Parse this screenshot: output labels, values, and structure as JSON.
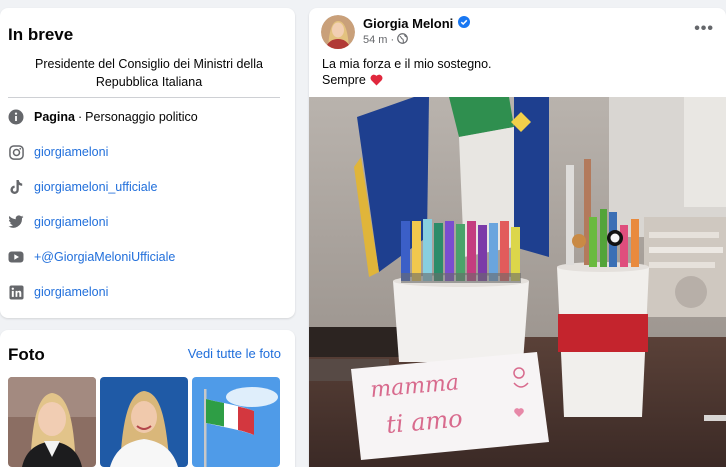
{
  "intro": {
    "title": "In breve",
    "bio": "Presidente del Consiglio dei Ministri della Repubblica Italiana",
    "category_label": "Pagina",
    "category_value": "Personaggio politico",
    "links": {
      "instagram": "giorgiameloni",
      "tiktok": "giorgiameloni_ufficiale",
      "twitter": "giorgiameloni",
      "youtube": "+@GiorgiaMeloniUfficiale",
      "linkedin": "giorgiameloni"
    }
  },
  "photos": {
    "title": "Foto",
    "see_all": "Vedi tutte le foto"
  },
  "post": {
    "author": "Giorgia Meloni",
    "time": "54 m",
    "separator": "·",
    "text_line1": "La mia forza e il mio sostegno.",
    "text_line2": "Sempre",
    "more": "•••",
    "note_text_1": "mamma",
    "note_text_2": "ti amo"
  },
  "colors": {
    "link": "#216fdb",
    "verified": "#1877f2",
    "secondary": "#65676b"
  }
}
